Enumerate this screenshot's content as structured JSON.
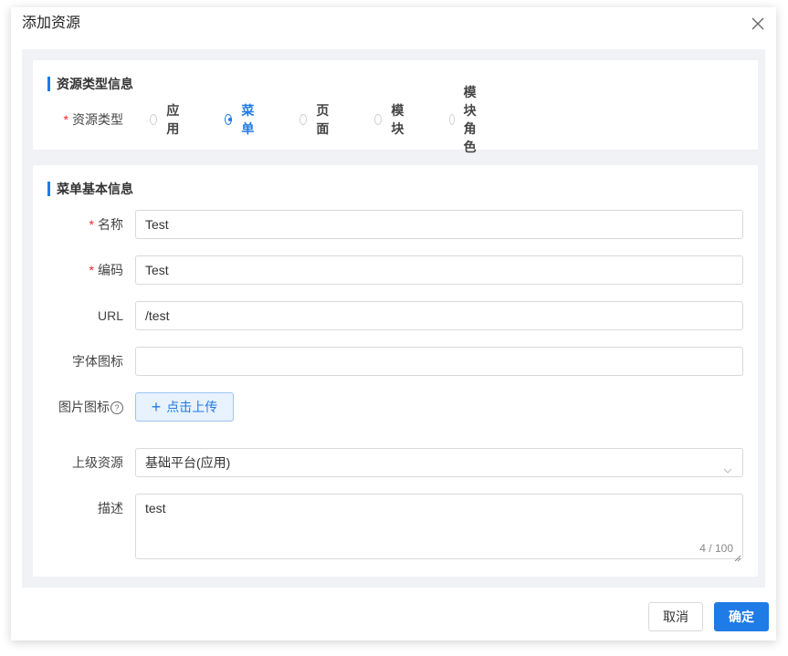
{
  "dialog": {
    "title": "添加资源",
    "close_icon": "close-icon"
  },
  "section1": {
    "title": "资源类型信息",
    "field_label": "资源类型",
    "required_mark": "*",
    "options": [
      {
        "label": "应用",
        "checked": false
      },
      {
        "label": "菜单",
        "checked": true
      },
      {
        "label": "页面",
        "checked": false
      },
      {
        "label": "模块",
        "checked": false
      },
      {
        "label": "模块角色",
        "checked": false
      }
    ]
  },
  "section2": {
    "title": "菜单基本信息",
    "name": {
      "label": "名称",
      "required": "*",
      "value": "Test"
    },
    "code": {
      "label": "编码",
      "required": "*",
      "value": "Test"
    },
    "url": {
      "label": "URL",
      "value": "/test"
    },
    "font_icon": {
      "label": "字体图标",
      "value": ""
    },
    "image_icon": {
      "label": "图片图标",
      "help_glyph": "?",
      "upload_label": "点击上传",
      "upload_plus": "+"
    },
    "parent": {
      "label": "上级资源",
      "value": "基础平台(应用)"
    },
    "description": {
      "label": "描述",
      "value": "test",
      "counter": "4 / 100"
    }
  },
  "footer": {
    "cancel_label": "取消",
    "ok_label": "确定"
  },
  "colors": {
    "primary": "#1f7be6",
    "required": "#f5222d",
    "body_bg": "#f0f2f5"
  }
}
